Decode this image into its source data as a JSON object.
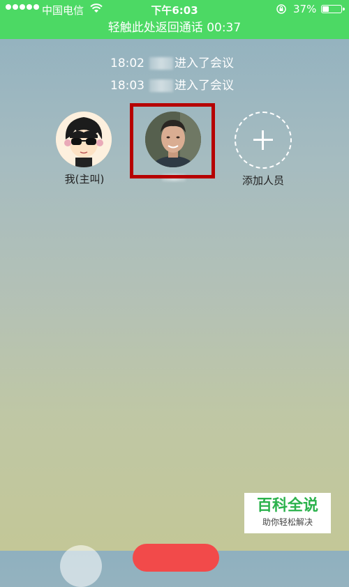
{
  "status_bar": {
    "carrier": "中国电信",
    "time": "下午6:03",
    "battery_percent": "37%",
    "battery_level": 0.37,
    "icons": [
      "signal-dots",
      "wifi-icon",
      "rotation-lock-icon",
      "battery-icon"
    ]
  },
  "call_banner": {
    "text": "轻触此处返回通话  00:37"
  },
  "log": [
    {
      "time": "18:02",
      "text": "进入了会议"
    },
    {
      "time": "18:03",
      "text": "进入了会议"
    }
  ],
  "participants": [
    {
      "name": "我(主叫)",
      "avatar": "cartoon-avatar"
    },
    {
      "name": "",
      "avatar": "photo-avatar",
      "highlighted": true
    }
  ],
  "add_member": {
    "label": "添加人员",
    "icon": "plus-icon"
  },
  "watermark": {
    "title": "百科全说",
    "subtitle": "助你轻松解决"
  },
  "colors": {
    "status_bar_bg": "#4cd964",
    "highlight_border": "#b60000",
    "watermark_green": "#2bb24c",
    "hangup_red": "#f24a4a"
  }
}
